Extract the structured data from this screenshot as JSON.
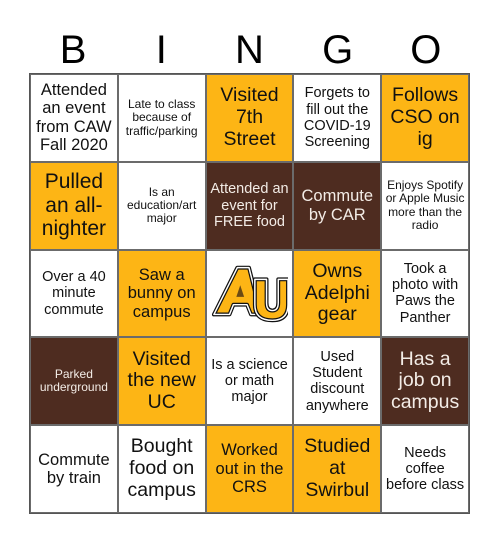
{
  "header": {
    "letters": [
      "B",
      "I",
      "N",
      "G",
      "O"
    ]
  },
  "colors": {
    "gold": "#fdb515",
    "brown": "#4e2c20",
    "white": "#ffffff"
  },
  "cells": [
    {
      "text": "Attended an event from CAW Fall 2020",
      "color": "white"
    },
    {
      "text": "Late to class because of traffic/parking",
      "color": "white"
    },
    {
      "text": "Visited 7th Street",
      "color": "gold"
    },
    {
      "text": "Forgets to fill out the COVID-19 Screening",
      "color": "white"
    },
    {
      "text": "Follows CSO on ig",
      "color": "gold"
    },
    {
      "text": "Pulled an all-nighter",
      "color": "gold"
    },
    {
      "text": "Is an education/art major",
      "color": "white"
    },
    {
      "text": "Attended an event for FREE food",
      "color": "brown"
    },
    {
      "text": "Commute by CAR",
      "color": "brown"
    },
    {
      "text": "Enjoys Spotify or Apple Music more than the radio",
      "color": "white"
    },
    {
      "text": "Over a 40 minute commute",
      "color": "white"
    },
    {
      "text": "Saw a bunny on campus",
      "color": "gold"
    },
    {
      "text": "AU",
      "color": "white",
      "free_space": true,
      "icon": "au-logo-icon"
    },
    {
      "text": "Owns Adelphi gear",
      "color": "gold"
    },
    {
      "text": "Took a photo with Paws the Panther",
      "color": "white"
    },
    {
      "text": "Parked underground",
      "color": "brown"
    },
    {
      "text": "Visited the new UC",
      "color": "gold"
    },
    {
      "text": "Is a science or math major",
      "color": "white"
    },
    {
      "text": "Used Student discount anywhere",
      "color": "white"
    },
    {
      "text": "Has a job on campus",
      "color": "brown"
    },
    {
      "text": "Commute by train",
      "color": "white"
    },
    {
      "text": "Bought food on campus",
      "color": "white"
    },
    {
      "text": "Worked out in the CRS",
      "color": "gold"
    },
    {
      "text": "Studied at Swirbul",
      "color": "gold"
    },
    {
      "text": "Needs coffee before class",
      "color": "white"
    }
  ]
}
